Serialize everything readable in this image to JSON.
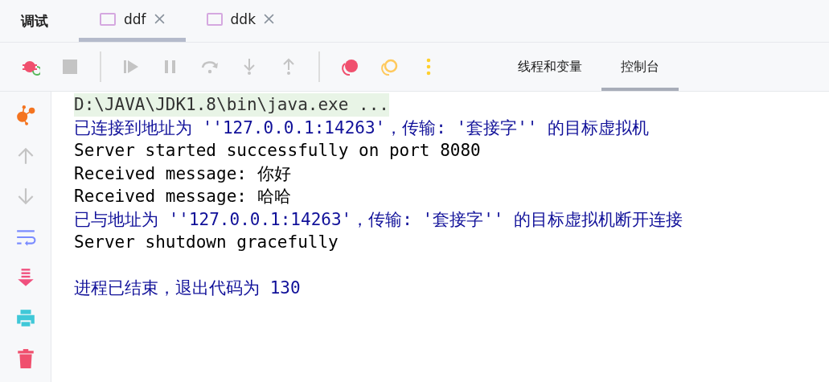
{
  "panel_title": "调试",
  "tabs": [
    {
      "label": "ddf",
      "selected": true
    },
    {
      "label": "ddk",
      "selected": false
    }
  ],
  "toolbar": [
    {
      "kind": "rerun",
      "disabled": false
    },
    {
      "kind": "stop",
      "disabled": true
    },
    {
      "kind": "resume",
      "disabled": true
    },
    {
      "kind": "pause",
      "disabled": true
    },
    {
      "kind": "step-over",
      "disabled": true
    },
    {
      "kind": "step-into",
      "disabled": true
    },
    {
      "kind": "step-out",
      "disabled": true
    },
    {
      "kind": "breakpoints",
      "disabled": false
    },
    {
      "kind": "mute",
      "disabled": false
    },
    {
      "kind": "more",
      "disabled": false
    }
  ],
  "view_tabs": [
    {
      "label": "线程和变量",
      "selected": false
    },
    {
      "label": "控制台",
      "selected": true
    }
  ],
  "side_tools": [
    {
      "kind": "graph",
      "disabled": false
    },
    {
      "kind": "up",
      "disabled": true
    },
    {
      "kind": "down",
      "disabled": true
    },
    {
      "kind": "wrap",
      "disabled": false
    },
    {
      "kind": "scroll-end",
      "disabled": false
    },
    {
      "kind": "print",
      "disabled": false
    },
    {
      "kind": "clear",
      "disabled": false
    }
  ],
  "console": [
    {
      "kind": "command",
      "text": "D:\\JAVA\\JDK1.8\\bin\\java.exe ..."
    },
    {
      "kind": "system",
      "text": "已连接到地址为 ''127.0.0.1:14263'，传输: '套接字'' 的目标虚拟机"
    },
    {
      "kind": "output",
      "text": "Server started successfully on port 8080"
    },
    {
      "kind": "output",
      "text": "Received message: 你好"
    },
    {
      "kind": "output",
      "text": "Received message: 哈哈"
    },
    {
      "kind": "system",
      "text": "已与地址为 ''127.0.0.1:14263'，传输: '套接字'' 的目标虚拟机断开连接"
    },
    {
      "kind": "output",
      "text": "Server shutdown gracefully"
    },
    {
      "kind": "blank"
    },
    {
      "kind": "system",
      "text": "进程已结束，退出代码为 130"
    }
  ]
}
